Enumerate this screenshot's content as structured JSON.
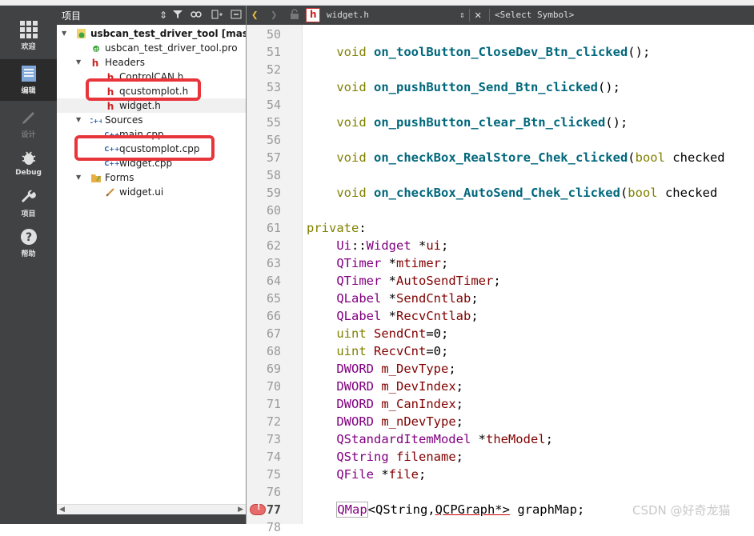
{
  "modes": [
    {
      "label": "欢迎",
      "icon": "grid-icon",
      "state": "normal"
    },
    {
      "label": "编辑",
      "icon": "edit-doc-icon",
      "state": "active"
    },
    {
      "label": "设计",
      "icon": "pen-icon",
      "state": "disabled"
    },
    {
      "label": "Debug",
      "icon": "bug-icon",
      "state": "normal"
    },
    {
      "label": "项目",
      "icon": "wrench-icon",
      "state": "normal"
    },
    {
      "label": "帮助",
      "icon": "help-icon",
      "state": "normal"
    }
  ],
  "project_pane": {
    "title": "项目",
    "tree": [
      {
        "label": "usbcan_test_driver_tool [master]",
        "depth": 0,
        "arrow": "down",
        "icon": "qt-project-icon",
        "bold": true
      },
      {
        "label": "usbcan_test_driver_tool.pro",
        "depth": 1,
        "arrow": "",
        "icon": "qt-pro-file-icon"
      },
      {
        "label": "Headers",
        "depth": 1,
        "arrow": "down",
        "icon": "header-folder-icon"
      },
      {
        "label": "ControlCAN.h",
        "depth": 2,
        "arrow": "",
        "icon": "header-file-icon"
      },
      {
        "label": "qcustomplot.h",
        "depth": 2,
        "arrow": "",
        "icon": "header-file-icon"
      },
      {
        "label": "widget.h",
        "depth": 2,
        "arrow": "",
        "icon": "header-file-icon",
        "selected": true
      },
      {
        "label": "Sources",
        "depth": 1,
        "arrow": "down",
        "icon": "source-folder-icon"
      },
      {
        "label": "main.cpp",
        "depth": 2,
        "arrow": "",
        "icon": "cpp-file-icon"
      },
      {
        "label": "qcustomplot.cpp",
        "depth": 2,
        "arrow": "",
        "icon": "cpp-file-icon"
      },
      {
        "label": "widget.cpp",
        "depth": 2,
        "arrow": "",
        "icon": "cpp-file-icon"
      },
      {
        "label": "Forms",
        "depth": 1,
        "arrow": "down",
        "icon": "forms-folder-icon"
      },
      {
        "label": "widget.ui",
        "depth": 2,
        "arrow": "",
        "icon": "ui-file-icon"
      }
    ]
  },
  "editor": {
    "file_name": "widget.h",
    "symbol_placeholder": "<Select Symbol>",
    "current_line": "77",
    "lines": [
      {
        "n": "50",
        "t": []
      },
      {
        "n": "51",
        "t": [
          [
            "    ",
            ""
          ],
          [
            "void",
            "kw"
          ],
          [
            " ",
            ""
          ],
          [
            "on_toolButton_CloseDev_Btn_clicked",
            "fn"
          ],
          [
            "();",
            ""
          ]
        ]
      },
      {
        "n": "52",
        "t": []
      },
      {
        "n": "53",
        "t": [
          [
            "    ",
            ""
          ],
          [
            "void",
            "kw"
          ],
          [
            " ",
            ""
          ],
          [
            "on_pushButton_Send_Btn_clicked",
            "fn"
          ],
          [
            "();",
            ""
          ]
        ]
      },
      {
        "n": "54",
        "t": []
      },
      {
        "n": "55",
        "t": [
          [
            "    ",
            ""
          ],
          [
            "void",
            "kw"
          ],
          [
            " ",
            ""
          ],
          [
            "on_pushButton_clear_Btn_clicked",
            "fn"
          ],
          [
            "();",
            ""
          ]
        ]
      },
      {
        "n": "56",
        "t": []
      },
      {
        "n": "57",
        "t": [
          [
            "    ",
            ""
          ],
          [
            "void",
            "kw"
          ],
          [
            " ",
            ""
          ],
          [
            "on_checkBox_RealStore_Chek_clicked",
            "fn"
          ],
          [
            "(",
            ""
          ],
          [
            "bool",
            "kw"
          ],
          [
            " checked",
            ""
          ]
        ]
      },
      {
        "n": "58",
        "t": []
      },
      {
        "n": "59",
        "t": [
          [
            "    ",
            ""
          ],
          [
            "void",
            "kw"
          ],
          [
            " ",
            ""
          ],
          [
            "on_checkBox_AutoSend_Chek_clicked",
            "fn"
          ],
          [
            "(",
            ""
          ],
          [
            "bool",
            "kw"
          ],
          [
            " checked",
            ""
          ]
        ]
      },
      {
        "n": "60",
        "t": []
      },
      {
        "n": "61",
        "t": [
          [
            "private",
            "kw"
          ],
          [
            ":",
            ""
          ]
        ]
      },
      {
        "n": "62",
        "t": [
          [
            "    ",
            ""
          ],
          [
            "Ui",
            "ty"
          ],
          [
            "::",
            ""
          ],
          [
            "Widget",
            "ty"
          ],
          [
            " *",
            ""
          ],
          [
            "ui",
            "mb"
          ],
          [
            ";",
            ""
          ]
        ]
      },
      {
        "n": "63",
        "t": [
          [
            "    ",
            ""
          ],
          [
            "QTimer",
            "ty"
          ],
          [
            " *",
            ""
          ],
          [
            "mtimer",
            "mb"
          ],
          [
            ";",
            ""
          ]
        ]
      },
      {
        "n": "64",
        "t": [
          [
            "    ",
            ""
          ],
          [
            "QTimer",
            "ty"
          ],
          [
            " *",
            ""
          ],
          [
            "AutoSendTimer",
            "mb"
          ],
          [
            ";",
            ""
          ]
        ]
      },
      {
        "n": "65",
        "t": [
          [
            "    ",
            ""
          ],
          [
            "QLabel",
            "ty"
          ],
          [
            " *",
            ""
          ],
          [
            "SendCntlab",
            "mb"
          ],
          [
            ";",
            ""
          ]
        ]
      },
      {
        "n": "66",
        "t": [
          [
            "    ",
            ""
          ],
          [
            "QLabel",
            "ty"
          ],
          [
            " *",
            ""
          ],
          [
            "RecvCntlab",
            "mb"
          ],
          [
            ";",
            ""
          ]
        ]
      },
      {
        "n": "67",
        "t": [
          [
            "    ",
            ""
          ],
          [
            "uint",
            "kw"
          ],
          [
            " ",
            ""
          ],
          [
            "SendCnt",
            "mb"
          ],
          [
            "=0;",
            ""
          ]
        ]
      },
      {
        "n": "68",
        "t": [
          [
            "    ",
            ""
          ],
          [
            "uint",
            "kw"
          ],
          [
            " ",
            ""
          ],
          [
            "RecvCnt",
            "mb"
          ],
          [
            "=0;",
            ""
          ]
        ]
      },
      {
        "n": "69",
        "t": [
          [
            "    ",
            ""
          ],
          [
            "DWORD",
            "ty"
          ],
          [
            " ",
            ""
          ],
          [
            "m_DevType",
            "mb"
          ],
          [
            ";",
            ""
          ]
        ]
      },
      {
        "n": "70",
        "t": [
          [
            "    ",
            ""
          ],
          [
            "DWORD",
            "ty"
          ],
          [
            " ",
            ""
          ],
          [
            "m_DevIndex",
            "mb"
          ],
          [
            ";",
            ""
          ]
        ]
      },
      {
        "n": "71",
        "t": [
          [
            "    ",
            ""
          ],
          [
            "DWORD",
            "ty"
          ],
          [
            " ",
            ""
          ],
          [
            "m_CanIndex",
            "mb"
          ],
          [
            ";",
            ""
          ]
        ]
      },
      {
        "n": "72",
        "t": [
          [
            "    ",
            ""
          ],
          [
            "DWORD",
            "ty"
          ],
          [
            " ",
            ""
          ],
          [
            "m_nDevType",
            "mb"
          ],
          [
            ";",
            ""
          ]
        ]
      },
      {
        "n": "73",
        "t": [
          [
            "    ",
            ""
          ],
          [
            "QStandardItemModel",
            "ty"
          ],
          [
            " *",
            ""
          ],
          [
            "theModel",
            "mb"
          ],
          [
            ";",
            ""
          ]
        ]
      },
      {
        "n": "74",
        "t": [
          [
            "    ",
            ""
          ],
          [
            "QString",
            "ty"
          ],
          [
            " ",
            ""
          ],
          [
            "filename",
            "mb"
          ],
          [
            ";",
            ""
          ]
        ]
      },
      {
        "n": "75",
        "t": [
          [
            "    ",
            ""
          ],
          [
            "QFile",
            "ty"
          ],
          [
            " *",
            ""
          ],
          [
            "file",
            "mb"
          ],
          [
            ";",
            ""
          ]
        ]
      },
      {
        "n": "76",
        "t": []
      },
      {
        "n": "77",
        "t": [
          [
            "    ",
            ""
          ],
          [
            "QMap",
            "ty box"
          ],
          [
            "<QString,",
            ""
          ],
          [
            "QCPGraph*>",
            "ul"
          ],
          [
            " graphMap;",
            ""
          ]
        ]
      },
      {
        "n": "78",
        "t": []
      }
    ]
  },
  "watermark": "CSDN @好奇龙猫",
  "colors": {
    "highlight": "#e8353b",
    "modebar": "#404244",
    "keyword": "#808000",
    "function": "#00677c",
    "type": "#800080",
    "member": "#800000"
  }
}
